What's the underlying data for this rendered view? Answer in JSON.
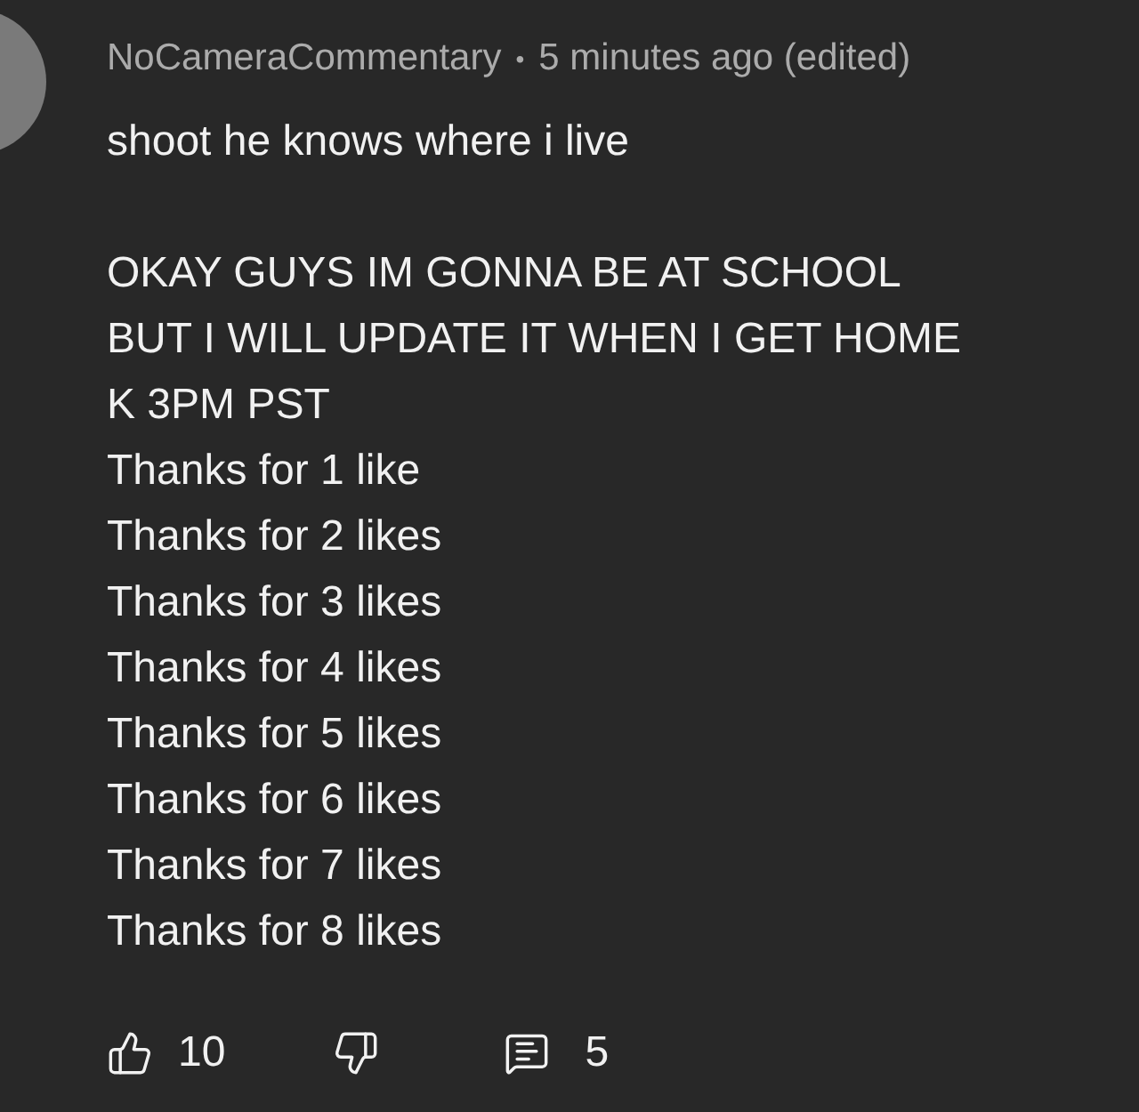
{
  "comment": {
    "author": "NoCameraCommentary",
    "separator": "•",
    "time": "5 minutes ago (edited)",
    "paragraphs": [
      [
        "shoot he knows where i live"
      ],
      [
        "OKAY GUYS IM GONNA BE AT SCHOOL",
        "BUT I WILL UPDATE IT WHEN I GET HOME",
        "K 3PM PST",
        "Thanks for 1 like",
        "Thanks for 2 likes",
        "Thanks for 3 likes",
        "Thanks for 4 likes",
        "Thanks for 5 likes",
        "Thanks for 6 likes",
        "Thanks for 7 likes",
        "Thanks for 8 likes"
      ]
    ],
    "likes": "10",
    "replies": "5"
  }
}
